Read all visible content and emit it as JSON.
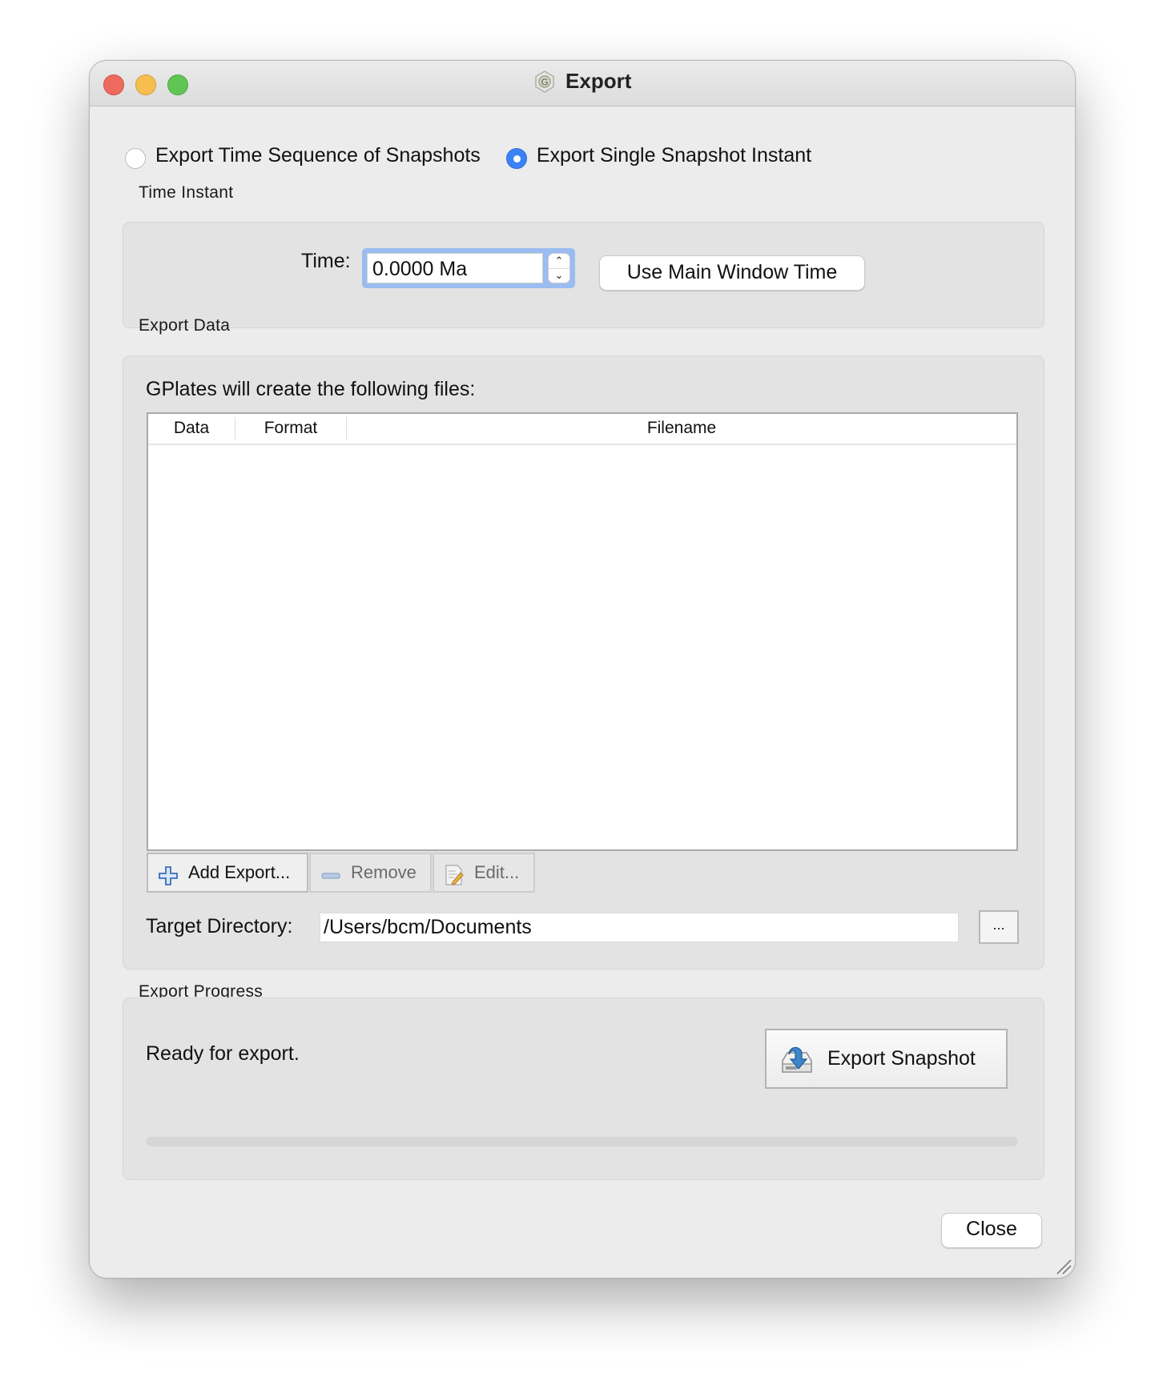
{
  "window": {
    "title": "Export",
    "app_icon": "gplates-hexagon-icon",
    "traffic_lights": {
      "close": "#ee6a5f",
      "minimize": "#f5be4f",
      "maximize": "#61c554"
    }
  },
  "mode": {
    "options": [
      {
        "label": "Export Time Sequence of Snapshots",
        "selected": false
      },
      {
        "label": "Export Single Snapshot Instant",
        "selected": true
      }
    ],
    "accent_color": "#3b82f6"
  },
  "time_instant": {
    "group_label": "Time Instant",
    "time_label": "Time:",
    "time_value": "0.0000 Ma",
    "spin_up_icon": "chevron-up-icon",
    "spin_down_icon": "chevron-down-icon",
    "use_main_window_time_label": "Use Main Window Time"
  },
  "export_data": {
    "group_label": "Export Data",
    "intro_text": "GPlates will create the following files:",
    "table": {
      "columns": [
        "Data",
        "Format",
        "Filename"
      ],
      "rows": []
    },
    "buttons": {
      "add": {
        "label": "Add Export...",
        "icon": "plus-icon",
        "enabled": true
      },
      "remove": {
        "label": "Remove",
        "icon": "minus-icon",
        "enabled": false
      },
      "edit": {
        "label": "Edit...",
        "icon": "edit-document-icon",
        "enabled": false
      }
    },
    "target_directory_label": "Target Directory:",
    "target_directory_value": "/Users/bcm/Documents",
    "browse_label": "..."
  },
  "export_progress": {
    "group_label": "Export Progress",
    "status": "Ready for export.",
    "export_button_label": "Export Snapshot",
    "export_button_icon": "export-drive-icon",
    "progress_percent": 0
  },
  "footer": {
    "close_label": "Close"
  }
}
